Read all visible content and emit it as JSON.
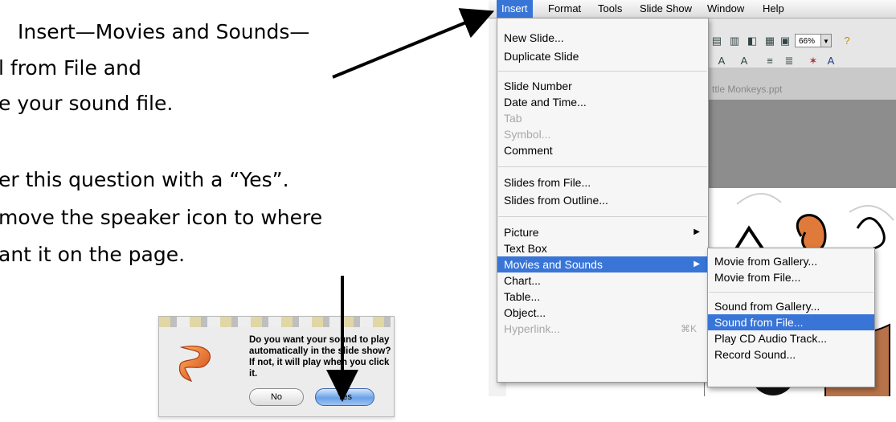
{
  "instructions": {
    "line1": "Insert—Movies and Sounds—",
    "line2": "l from File and",
    "line3": "e your sound file.",
    "line4": "er this question with a “Yes”.",
    "line5": "move the speaker icon to where",
    "line6": "ant it on the page."
  },
  "dialog": {
    "message": "Do you want your sound to play automatically in the slide show? If not, it will play when you click it.",
    "no_label": "No",
    "yes_label": "Yes"
  },
  "menubar": [
    "Insert",
    "Format",
    "Tools",
    "Slide Show",
    "Window",
    "Help"
  ],
  "insert_menu": {
    "groups": [
      [
        "New Slide...",
        "Duplicate Slide"
      ],
      [
        "Slide Number",
        "Date and Time...",
        "Tab",
        "Symbol...",
        "Comment"
      ],
      [
        "Slides from File...",
        "Slides from Outline..."
      ],
      [
        "Picture",
        "Text Box",
        "Movies and Sounds",
        "Chart...",
        "Table...",
        "Object...",
        "Hyperlink..."
      ]
    ],
    "hyperlink_shortcut": "⌘K"
  },
  "submenu": {
    "items": [
      "Movie from Gallery...",
      "Movie from File...",
      "Sound from Gallery...",
      "Sound from File...",
      "Play CD Audio Track...",
      "Record Sound..."
    ]
  },
  "toolbar": {
    "zoom": "66%"
  },
  "document_title": "ttle Monkeys.ppt",
  "colors": {
    "menu_highlight": "#3875d7",
    "dialog_bg": "#ececec",
    "gray_pane": "#8d8d8d"
  }
}
